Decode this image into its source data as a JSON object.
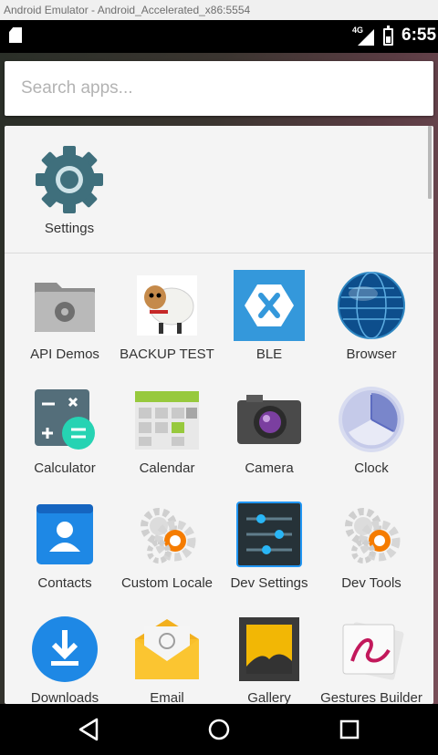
{
  "window": {
    "title": "Android Emulator - Android_Accelerated_x86:5554"
  },
  "status_bar": {
    "network": "4G",
    "time": "6:55"
  },
  "search": {
    "placeholder": "Search apps..."
  },
  "suggested": [
    {
      "label": "Settings",
      "icon": "settings-gear-icon"
    }
  ],
  "apps": [
    {
      "label": "API Demos",
      "icon": "folder-gear-icon"
    },
    {
      "label": "BACKUP TEST",
      "icon": "sheep-icon"
    },
    {
      "label": "BLE",
      "icon": "xamarin-x-icon"
    },
    {
      "label": "Browser",
      "icon": "globe-icon"
    },
    {
      "label": "Calculator",
      "icon": "calculator-icon"
    },
    {
      "label": "Calendar",
      "icon": "calendar-grid-icon"
    },
    {
      "label": "Camera",
      "icon": "camera-icon"
    },
    {
      "label": "Clock",
      "icon": "clock-icon"
    },
    {
      "label": "Contacts",
      "icon": "contacts-card-icon"
    },
    {
      "label": "Custom Locale",
      "icon": "gears-icon"
    },
    {
      "label": "Dev Settings",
      "icon": "sliders-icon"
    },
    {
      "label": "Dev Tools",
      "icon": "gears-icon"
    },
    {
      "label": "Downloads",
      "icon": "download-arrow-icon"
    },
    {
      "label": "Email",
      "icon": "envelope-icon"
    },
    {
      "label": "Gallery",
      "icon": "picture-frame-icon"
    },
    {
      "label": "Gestures Builder",
      "icon": "gesture-card-icon"
    }
  ],
  "navigation": {
    "back": "back-triangle-icon",
    "home": "home-circle-icon",
    "recents": "recents-square-icon"
  },
  "colors": {
    "drawer_bg": "#f4f4f4",
    "label_text": "#333333",
    "placeholder": "#b3b3b3"
  }
}
